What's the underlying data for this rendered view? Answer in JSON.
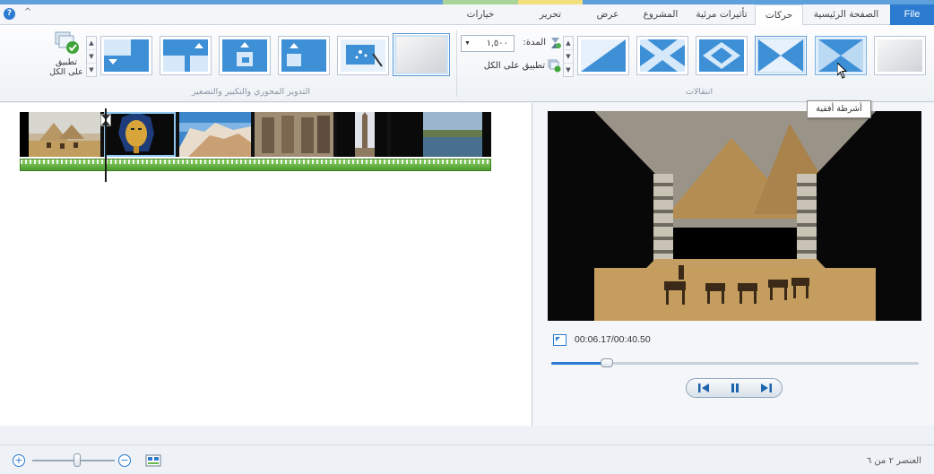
{
  "tabs": [
    {
      "label": "File"
    },
    {
      "label": "الصفحة الرئيسية"
    },
    {
      "label": "حركات"
    },
    {
      "label": "تأثيرات مرئية"
    },
    {
      "label": "المشروع"
    },
    {
      "label": "عرض"
    },
    {
      "label": "تحرير"
    },
    {
      "label": "خيارات"
    }
  ],
  "active_tab": "حركات",
  "help_glyph": "?",
  "collapse_glyph": "^",
  "ribbon": {
    "transitions_group_label": "انتقالات",
    "pan_zoom_group_label": "التدوير المحوري والتكبير والتصغير",
    "duration_label": "المدة:",
    "duration_value": "١,٥٠٠",
    "apply_all_label": "تطبيق على الكل",
    "apply_all_big_line1": "تطبيق",
    "apply_all_big_line2": "على الكل",
    "tooltip": "أشرطة أفقية",
    "transition_icons": [
      "no-transition-icon",
      "horizontal-bars-transition-icon",
      "vertical-bars-transition-icon",
      "diamond-transition-icon",
      "cross-transition-icon",
      "diagonal-transition-icon"
    ],
    "pan_zoom_icons": [
      "no-pan-zoom-icon",
      "automatic-pan-zoom-icon",
      "pan-up-icon",
      "zoom-in-up-icon",
      "zoom-in-up-right-icon",
      "pan-down-icon"
    ]
  },
  "preview": {
    "timecode": "00:06.17/00:40.50",
    "progress": 0.15
  },
  "status": {
    "item_text": "العنصر ٢ من ٦",
    "zoom_in_glyph": "+",
    "zoom_out_glyph": "−"
  },
  "colors": {
    "accent": "#2b7bd1",
    "selection": "#cfe3f7",
    "audio_green": "#6ab84a"
  }
}
